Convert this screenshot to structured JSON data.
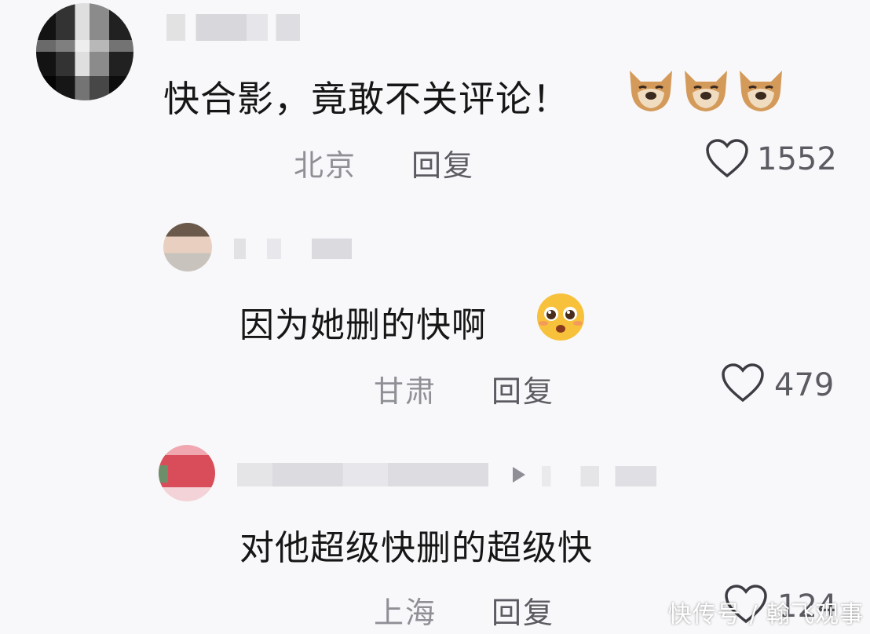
{
  "comments": [
    {
      "text": "快合影，竟敢不关评论！",
      "location": "北京",
      "reply_label": "回复",
      "likes": "1552",
      "emoji": "dog-face-icon"
    },
    {
      "text": "因为她删的快啊",
      "location": "甘肃",
      "reply_label": "回复",
      "likes": "479",
      "emoji": "pleading-face-icon"
    },
    {
      "text": "对他超级快删的超级快",
      "location": "上海",
      "reply_label": "回复",
      "likes": "124"
    }
  ],
  "watermark": "快传号 / 翰飞观事",
  "colors": {
    "background": "#f8f8fa",
    "text": "#161616",
    "muted": "#8f8f96",
    "action": "#5b5b62"
  }
}
